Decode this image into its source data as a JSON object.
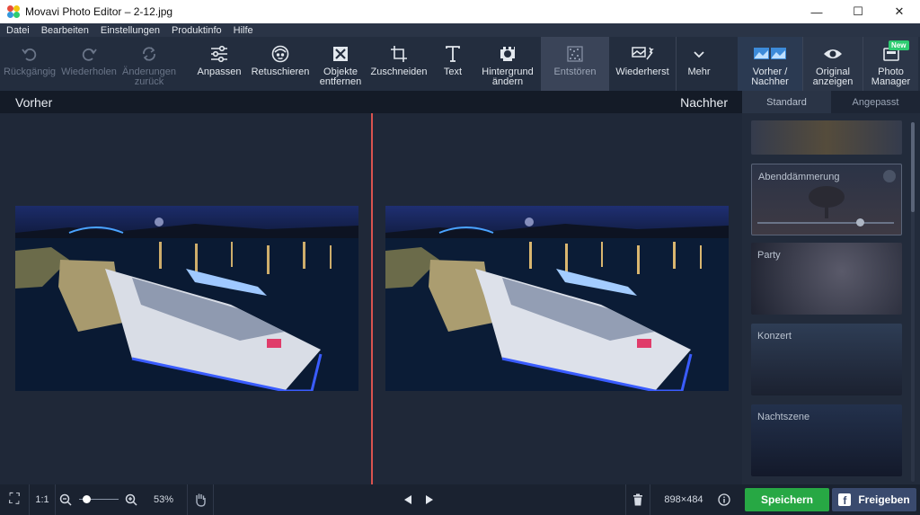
{
  "window": {
    "title": "Movavi Photo Editor – 2-12.jpg",
    "minimize": "—",
    "maximize": "☐",
    "close": "✕"
  },
  "menu": [
    "Datei",
    "Bearbeiten",
    "Einstellungen",
    "Produktinfo",
    "Hilfe"
  ],
  "toolbar": {
    "undo": "Rückgängig",
    "redo": "Wiederholen",
    "revert_line1": "Änderungen",
    "revert_line2": "zurück",
    "adjust": "Anpassen",
    "retouch": "Retuschieren",
    "objects_line1": "Objekte",
    "objects_line2": "entfernen",
    "crop": "Zuschneiden",
    "text": "Text",
    "background_line1": "Hintergrund",
    "background_line2": "ändern",
    "denoise": "Entstören",
    "restore": "Wiederherst",
    "more": "Mehr",
    "before_after_line1": "Vorher /",
    "before_after_line2": "Nachher",
    "original_line1": "Original",
    "original_line2": "anzeigen",
    "manager_line1": "Photo",
    "manager_line2": "Manager",
    "new_badge": "New"
  },
  "compare": {
    "before": "Vorher",
    "after": "Nachher"
  },
  "side": {
    "tab_standard": "Standard",
    "tab_custom": "Angepasst",
    "presets": [
      "Abenddämmerung",
      "Party",
      "Konzert",
      "Nachtszene"
    ]
  },
  "status": {
    "fit": "⛶",
    "one_to_one": "1:1",
    "zoom_value": 0.2,
    "zoom_percent": "53%",
    "dimensions": "898×484",
    "save": "Speichern",
    "share": "Freigeben"
  },
  "colors": {
    "accent_save": "#27a844",
    "divider": "#d9534f",
    "share": "#3a4a6e"
  }
}
